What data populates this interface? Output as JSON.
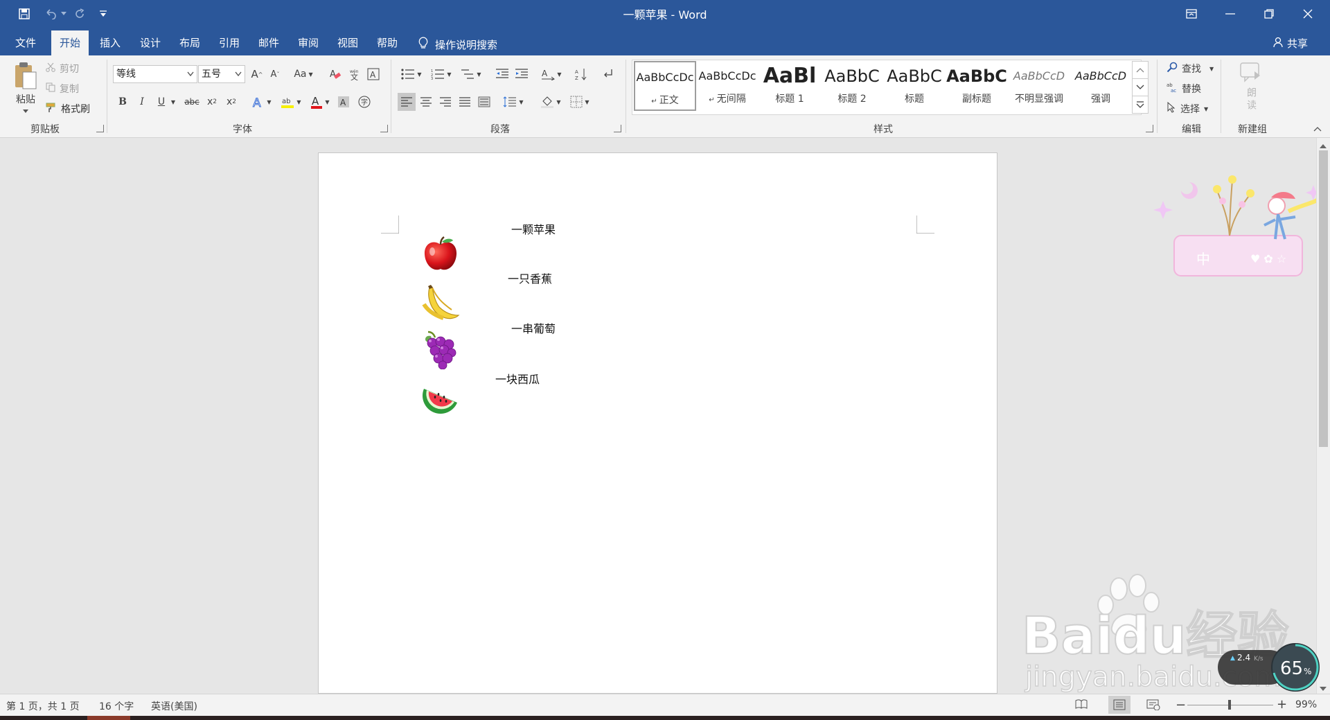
{
  "window": {
    "title": "一颗苹果 - Word"
  },
  "quick_access": {
    "icons": [
      "save-icon",
      "undo-icon",
      "redo-icon",
      "customize-quick-access-icon"
    ]
  },
  "title_controls": {
    "icons": [
      "ribbon-display-options-icon",
      "minimize-icon",
      "restore-icon",
      "close-icon"
    ]
  },
  "tabs": [
    {
      "label": "文件"
    },
    {
      "label": "开始",
      "active": true
    },
    {
      "label": "插入"
    },
    {
      "label": "设计"
    },
    {
      "label": "布局"
    },
    {
      "label": "引用"
    },
    {
      "label": "邮件"
    },
    {
      "label": "审阅"
    },
    {
      "label": "视图"
    },
    {
      "label": "帮助"
    }
  ],
  "tellme": {
    "label": "操作说明搜索"
  },
  "share": {
    "label": "共享"
  },
  "clipboard": {
    "group": "剪贴板",
    "paste": "粘贴",
    "cut": "剪切",
    "copy": "复制",
    "format_painter": "格式刷"
  },
  "font": {
    "group": "字体",
    "family": "等线",
    "size": "五号",
    "bold": "B",
    "italic": "I",
    "underline": "U",
    "strike": "abc",
    "change_case": "Aa"
  },
  "paragraph": {
    "group": "段落"
  },
  "styles": {
    "group": "样式",
    "items": [
      {
        "preview": "AaBbCcDc",
        "name": "正文"
      },
      {
        "preview": "AaBbCcDc",
        "name": "无间隔"
      },
      {
        "preview": "AaBl",
        "name": "标题 1"
      },
      {
        "preview": "AaBbC",
        "name": "标题 2"
      },
      {
        "preview": "AaBbC",
        "name": "标题"
      },
      {
        "preview": "AaBbC",
        "name": "副标题"
      },
      {
        "preview": "AaBbCcD",
        "name": "不明显强调"
      },
      {
        "preview": "AaBbCcD",
        "name": "强调"
      }
    ]
  },
  "editing": {
    "group": "编辑",
    "find": "查找",
    "replace": "替换",
    "select": "选择"
  },
  "newgroup": {
    "group": "新建组",
    "read_aloud": "朗读"
  },
  "document": {
    "lines": [
      {
        "icon": "apple-icon",
        "text": "一颗苹果"
      },
      {
        "icon": "banana-icon",
        "text": "一只香蕉"
      },
      {
        "icon": "grapes-icon",
        "text": "一串葡萄"
      },
      {
        "icon": "watermelon-icon",
        "text": "一块西瓜"
      }
    ]
  },
  "status": {
    "page": "第 1 页，共 1 页",
    "words": "16 个字",
    "language": "英语(美国)",
    "zoom": "99%"
  },
  "overlay": {
    "watermark_text": "Baidu经验",
    "watermark_url": "jingyan.baidu.com",
    "sticker_text": "中",
    "net_speed_up": "2.4",
    "net_speed_unit": "K/s",
    "cpu_percent": "65",
    "percent_sign": "%"
  }
}
